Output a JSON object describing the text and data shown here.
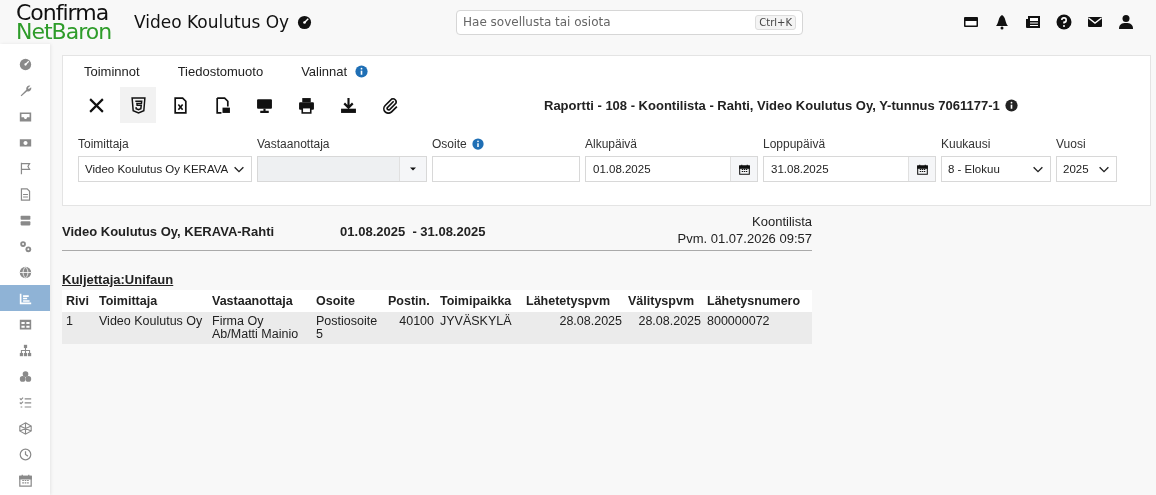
{
  "header": {
    "logo": {
      "line_1": "Confirma",
      "line_2": "NetBaron"
    },
    "company": "Video Koulutus Oy",
    "search": {
      "placeholder": "Hae sovellusta tai osiota",
      "shortcut": "Ctrl+K"
    }
  },
  "sidebar": {
    "items": [
      {
        "selected": false
      },
      {
        "selected": false
      },
      {
        "selected": false
      },
      {
        "selected": false
      },
      {
        "selected": false
      },
      {
        "selected": false
      },
      {
        "selected": false
      },
      {
        "selected": false
      },
      {
        "selected": false
      },
      {
        "selected": true
      },
      {
        "selected": false
      },
      {
        "selected": false
      },
      {
        "selected": false
      },
      {
        "selected": false
      },
      {
        "selected": false
      },
      {
        "selected": false
      },
      {
        "selected": false
      }
    ]
  },
  "panel": {
    "menu": [
      {
        "label": "Toiminnot",
        "info": false
      },
      {
        "label": "Tiedostomuoto",
        "info": false
      },
      {
        "label": "Valinnat",
        "info": true
      }
    ],
    "toolbar": [
      {
        "selected": false
      },
      {
        "selected": true
      },
      {
        "selected": false
      },
      {
        "selected": false
      },
      {
        "selected": false
      },
      {
        "selected": false
      },
      {
        "selected": false
      },
      {
        "selected": false
      }
    ],
    "report_title": "Raportti - 108 - Koontilista - Rahti, Video Koulutus Oy, Y-tunnus 7061177-1",
    "filters": [
      {
        "label": "Toimittaja",
        "kind": "select",
        "value": "Video Koulutus Oy KERAVA",
        "info": false,
        "disabled": false
      },
      {
        "label": "Vastaanottaja",
        "kind": "combo",
        "info": false,
        "disabled": true
      },
      {
        "label": "Osoite",
        "kind": "text",
        "info": true,
        "disabled": false
      },
      {
        "label": "Alkupäivä",
        "kind": "date",
        "value": "01.08.2025",
        "info": false,
        "disabled": false
      },
      {
        "label": "Loppupäivä",
        "kind": "date",
        "value": "31.08.2025",
        "info": false,
        "disabled": false
      },
      {
        "label": "Kuukausi",
        "kind": "select",
        "value": "8 - Elokuu",
        "info": false,
        "disabled": false
      },
      {
        "label": "Vuosi",
        "kind": "select",
        "value": "2025",
        "info": false,
        "disabled": false
      }
    ]
  },
  "report": {
    "company": "Video Koulutus Oy, KERAVA-Rahti",
    "period": "01.08.2025  - 31.08.2025",
    "name": "Koontilista",
    "printed": "Pvm. 01.07.2026 09:57",
    "carrier": "Kuljettaja:Unifaun",
    "table": {
      "columns": [
        "Rivi",
        "Toimittaja",
        "Vastaanottaja",
        "Osoite",
        "Postin.",
        "Toimipaikka",
        "Lähetetyspvm",
        "Välityspvm",
        "Lähetysnumero"
      ],
      "rows": [
        [
          "1",
          "Video Koulutus Oy",
          "Firma Oy Ab/Matti Mainio",
          "Postiosoite 5",
          "40100",
          "JYVÄSKYLÄ",
          "28.08.2025",
          "28.08.2025",
          "800000072"
        ]
      ]
    }
  }
}
